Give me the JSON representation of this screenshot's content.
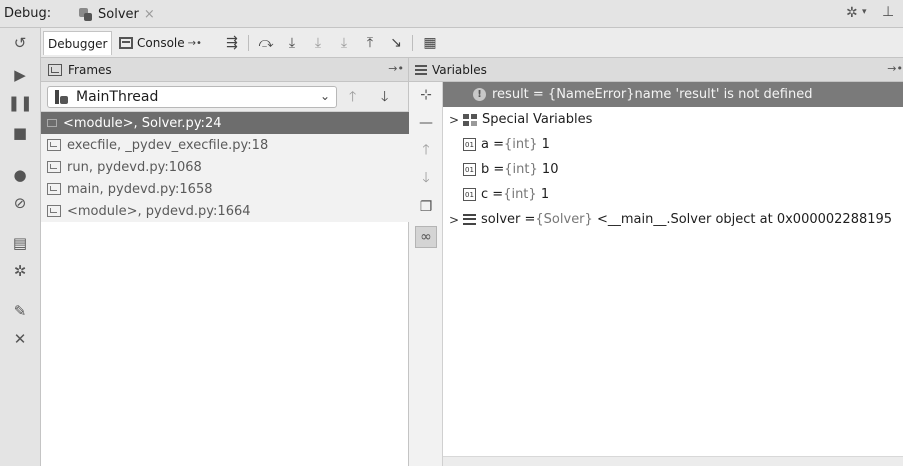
{
  "topbar": {
    "debug_label": "Debug:",
    "session_tab": "Solver",
    "close_glyph": "×"
  },
  "toolbar": {
    "debugger_tab": "Debugger",
    "console_tab": "Console"
  },
  "frames": {
    "title": "Frames",
    "thread": "MainThread",
    "items": [
      {
        "label": "<module>, Solver.py:24",
        "selected": true
      },
      {
        "label": "execfile, _pydev_execfile.py:18",
        "selected": false
      },
      {
        "label": "run, pydevd.py:1068",
        "selected": false
      },
      {
        "label": "main, pydevd.py:1658",
        "selected": false
      },
      {
        "label": "<module>, pydevd.py:1664",
        "selected": false
      }
    ]
  },
  "variables": {
    "title": "Variables",
    "items": [
      {
        "name": "result",
        "text": "result = {NameError}name 'result' is not defined"
      },
      {
        "name": "special",
        "text": "Special Variables"
      },
      {
        "name": "a",
        "prefix": "a = ",
        "type": "{int}",
        "value": "1"
      },
      {
        "name": "b",
        "prefix": "b = ",
        "type": "{int}",
        "value": "10"
      },
      {
        "name": "c",
        "prefix": "c = ",
        "type": "{int}",
        "value": "1"
      },
      {
        "name": "solver",
        "prefix": "solver = ",
        "type": "{Solver}",
        "value": "<__main__.Solver object at 0x000002288195"
      }
    ]
  },
  "icons": {
    "left_toolbar": [
      "resume-icon",
      "pause-icon",
      "stop-icon",
      "view-breakpoints-icon",
      "mute-breakpoints-icon",
      "layout-icon",
      "settings-icon",
      "pin-icon",
      "close-icon"
    ],
    "debug_toolbar": [
      "show-execution-point-icon",
      "step-over-icon",
      "step-into-icon",
      "step-into-my-code-icon",
      "force-step-into-icon",
      "step-out-icon",
      "run-to-cursor-icon",
      "evaluate-expression-icon"
    ],
    "variables_side": [
      "new-watch-icon",
      "remove-watch-icon",
      "move-up-icon",
      "move-down-icon",
      "copy-watch-icon",
      "watch-toggle-icon"
    ]
  },
  "colors": {
    "selected_frame_bg": "#6d6d6d",
    "error_row_bg": "#7a7a7a",
    "toolbar_bg": "#e4e4e4"
  }
}
